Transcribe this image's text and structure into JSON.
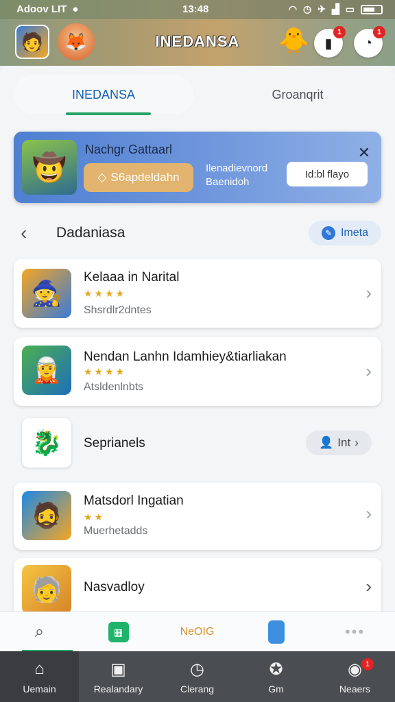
{
  "status": {
    "carrier": "Adoov LIT",
    "time": "13:48"
  },
  "header": {
    "title": "INEDANSA",
    "notif_badge_1": "1",
    "notif_badge_2": "1"
  },
  "tabs": [
    {
      "label": "INEDANSA"
    },
    {
      "label": "Groanqrit"
    }
  ],
  "promo": {
    "title": "Nachgr Gattaarl",
    "button": "S6apdeldahn",
    "description": "Ilenadievnord Baenidoh",
    "secondary_button": "Id:bl flayo",
    "close": "✕"
  },
  "section": {
    "title": "Dadaniasa",
    "pill": "Imeta"
  },
  "list": [
    {
      "name": "Kelaaa in Narital",
      "stars": "★★★★",
      "sub": "Shsrdlr2dntes"
    },
    {
      "name": "Nendan Lanhn Idamhiey&tiarliakan",
      "stars": "★★★★",
      "sub": "Atsldenlnbts"
    },
    {
      "name": "Seprianels",
      "pill": "Int"
    },
    {
      "name": "Matsdorl Ingatian",
      "stars": "★★",
      "sub": "Muerhetadds"
    },
    {
      "name": "Nasvadloy"
    }
  ],
  "toolbar": {
    "center_label": "NeOIG"
  },
  "navbar": [
    {
      "label": "Uemain"
    },
    {
      "label": "Realandary"
    },
    {
      "label": "Clerang"
    },
    {
      "label": "Gm"
    },
    {
      "label": "Neaers",
      "badge": "1"
    }
  ]
}
